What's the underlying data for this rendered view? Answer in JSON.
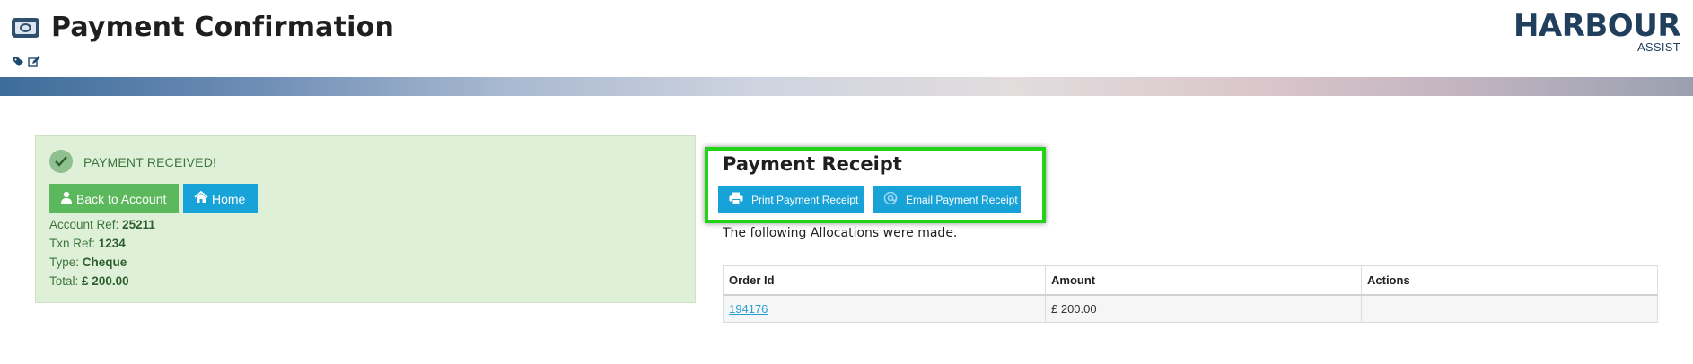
{
  "header": {
    "title": "Payment Confirmation",
    "icons": [
      "money-bill-icon",
      "tags-icon",
      "edit-icon"
    ],
    "logo_main": "HARBOUR",
    "logo_sub": "ASSIST"
  },
  "success": {
    "message": "PAYMENT RECEIVED!",
    "back_button": "Back to Account",
    "home_button": "Home",
    "account_ref_label": "Account Ref:",
    "account_ref": "25211",
    "txn_ref_label": "Txn Ref:",
    "txn_ref": "1234",
    "type_label": "Type:",
    "type": "Cheque",
    "total_label": "Total:",
    "total": "£ 200.00"
  },
  "receipt": {
    "title": "Payment Receipt",
    "print_button": "Print Payment Receipt",
    "email_button": "Email Payment Receipt",
    "allocations_text": "The following Allocations were made."
  },
  "table": {
    "headers": [
      "Order Id",
      "Amount",
      "Actions"
    ],
    "rows": [
      {
        "order_id": "194176",
        "amount": "£ 200.00",
        "actions": ""
      }
    ]
  },
  "colors": {
    "success_bg": "#dff0d8",
    "success_text": "#3c763d",
    "green_button": "#5cb85c",
    "blue_button": "#17a2d8",
    "highlight": "#21d418",
    "logo": "#1f3f5c"
  }
}
